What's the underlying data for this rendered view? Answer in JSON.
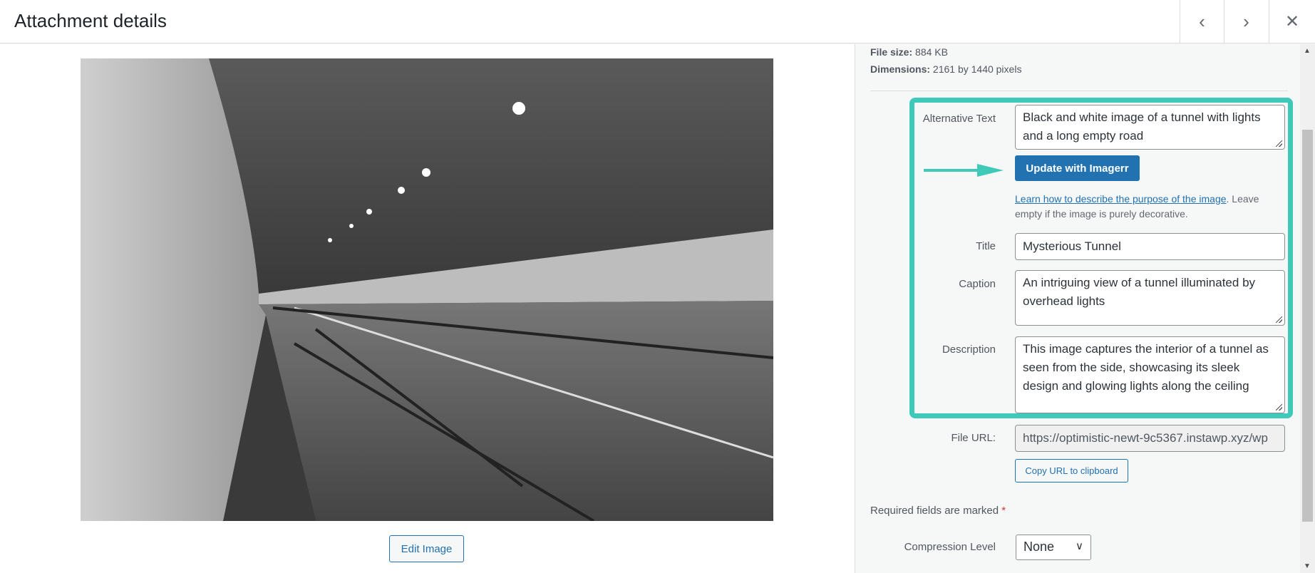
{
  "header": {
    "title": "Attachment details",
    "prev_icon": "chevron-left-icon",
    "next_icon": "chevron-right-icon",
    "close_icon": "close-icon"
  },
  "preview": {
    "edit_label": "Edit Image"
  },
  "meta": {
    "file_size_label": "File size:",
    "file_size": "884 KB",
    "dimensions_label": "Dimensions:",
    "dimensions": "2161 by 1440 pixels"
  },
  "form": {
    "alt_label": "Alternative Text",
    "alt_value": "Black and white image of a tunnel with lights and a long empty road",
    "update_label": "Update with Imagerr",
    "help_link": "Learn how to describe the purpose of the image",
    "help_rest": ". Leave empty if the image is purely decorative.",
    "title_label": "Title",
    "title_value": "Mysterious Tunnel",
    "caption_label": "Caption",
    "caption_value": "An intriguing view of a tunnel illuminated by overhead lights",
    "description_label": "Description",
    "description_value": "This image captures the interior of a tunnel as seen from the side, showcasing its sleek design and glowing lights along the ceiling",
    "url_label": "File URL:",
    "url_value": "https://optimistic-newt-9c5367.instawp.xyz/wp",
    "copy_label": "Copy URL to clipboard",
    "required_text": "Required fields are marked",
    "required_star": "*",
    "compression_label": "Compression Level",
    "compression_value": "None"
  },
  "colors": {
    "accent": "#2271b1",
    "highlight": "#3ec9b8"
  }
}
